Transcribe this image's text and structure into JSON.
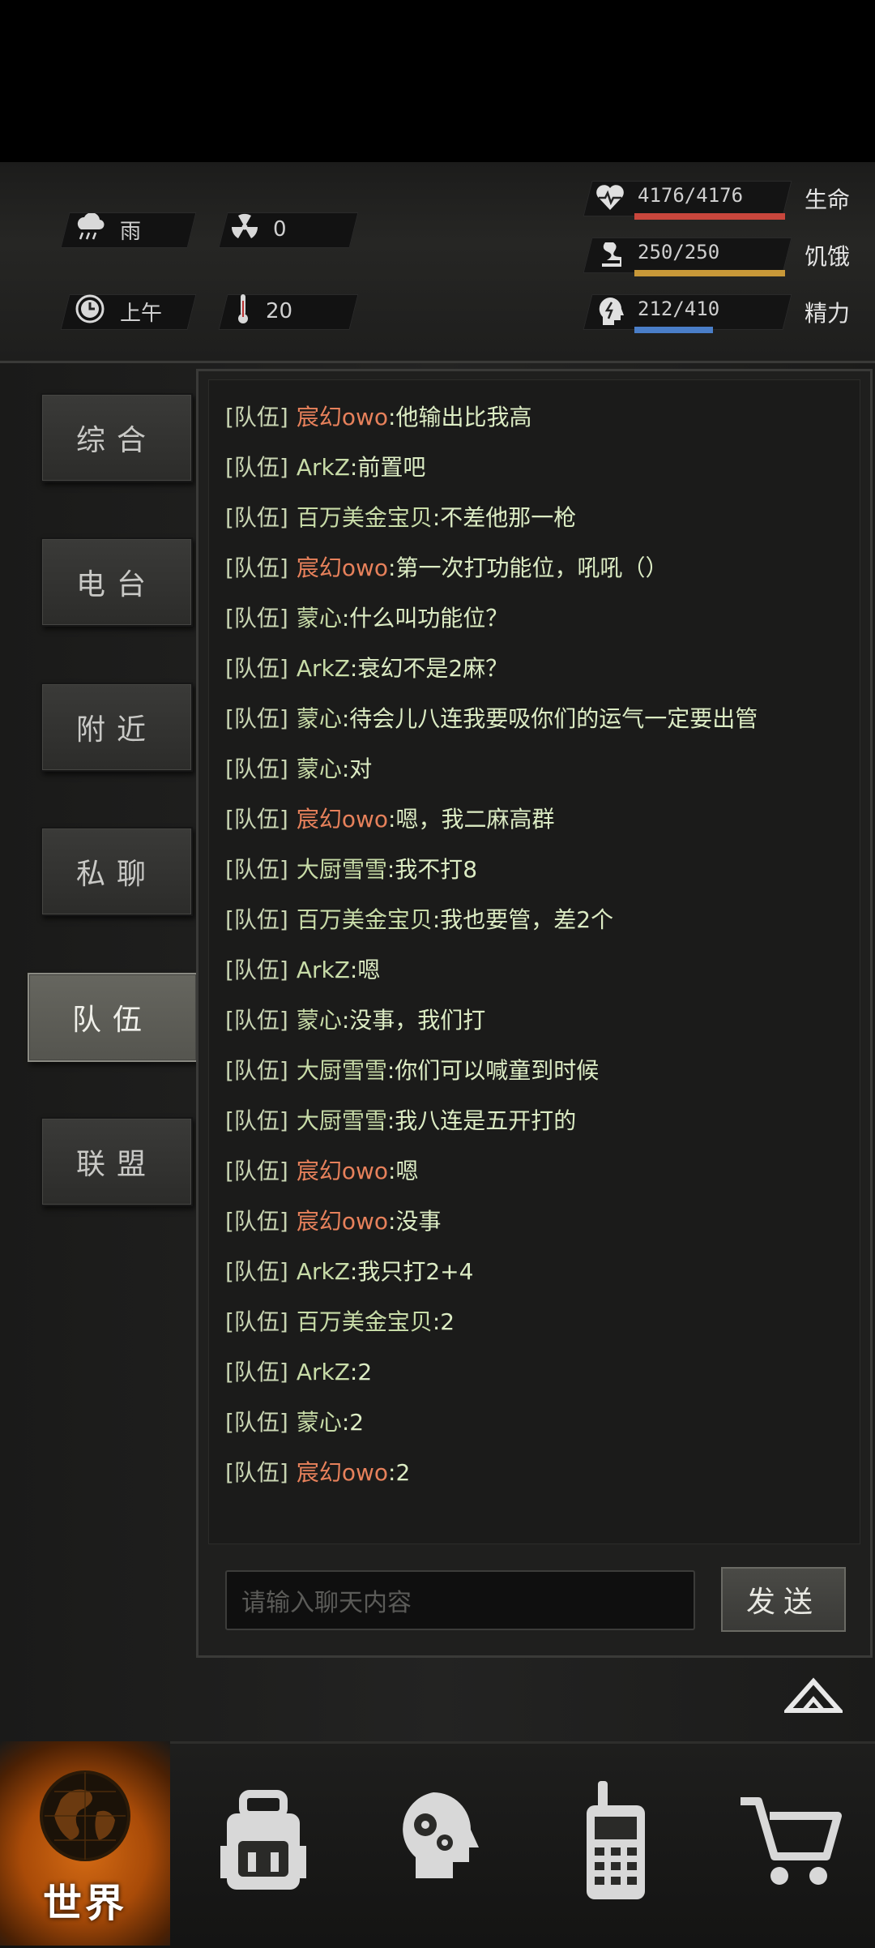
{
  "status": {
    "weather": {
      "icon": "rain-cloud-icon",
      "label": "雨"
    },
    "radiation": {
      "icon": "radiation-icon",
      "value": "0"
    },
    "time": {
      "icon": "clock-icon",
      "label": "上午"
    },
    "temperature": {
      "icon": "thermometer-icon",
      "value": "20"
    },
    "stats": [
      {
        "icon": "heart-pulse-icon",
        "value": "4176/4176",
        "label": "生命",
        "fill": 1.0,
        "color": "#c8463c"
      },
      {
        "icon": "hunger-icon",
        "value": "250/250",
        "label": "饥饿",
        "fill": 1.0,
        "color": "#c89838"
      },
      {
        "icon": "energy-head-icon",
        "value": "212/410",
        "label": "精力",
        "fill": 0.52,
        "color": "#4a7ec8"
      }
    ]
  },
  "tabs": [
    {
      "label": "综合",
      "active": false
    },
    {
      "label": "电台",
      "active": false
    },
    {
      "label": "附近",
      "active": false
    },
    {
      "label": "私聊",
      "active": false
    },
    {
      "label": "队伍",
      "active": true
    },
    {
      "label": "联盟",
      "active": false
    }
  ],
  "chat": {
    "messages": [
      {
        "channel": "[队伍]",
        "name": "宸幻owo",
        "orange": true,
        "text": ":他输出比我高"
      },
      {
        "channel": "[队伍]",
        "name": "ArkZ",
        "orange": false,
        "text": ":前置吧"
      },
      {
        "channel": "[队伍]",
        "name": "百万美金宝贝",
        "orange": false,
        "text": ":不差他那一枪"
      },
      {
        "channel": "[队伍]",
        "name": "宸幻owo",
        "orange": true,
        "text": ":第一次打功能位，吼吼（）"
      },
      {
        "channel": "[队伍]",
        "name": "蒙心",
        "orange": false,
        "text": ":什么叫功能位？"
      },
      {
        "channel": "[队伍]",
        "name": "ArkZ",
        "orange": false,
        "text": ":衰幻不是2麻？"
      },
      {
        "channel": "[队伍]",
        "name": "蒙心",
        "orange": false,
        "text": ":待会儿八连我要吸你们的运气一定要出管"
      },
      {
        "channel": "[队伍]",
        "name": "蒙心",
        "orange": false,
        "text": ":对"
      },
      {
        "channel": "[队伍]",
        "name": "宸幻owo",
        "orange": true,
        "text": ":嗯，我二麻高群"
      },
      {
        "channel": "[队伍]",
        "name": "大厨雪雪",
        "orange": false,
        "text": ":我不打8"
      },
      {
        "channel": "[队伍]",
        "name": "百万美金宝贝",
        "orange": false,
        "text": ":我也要管，差2个"
      },
      {
        "channel": "[队伍]",
        "name": "ArkZ",
        "orange": false,
        "text": ":嗯"
      },
      {
        "channel": "[队伍]",
        "name": "蒙心",
        "orange": false,
        "text": ":没事，我们打"
      },
      {
        "channel": "[队伍]",
        "name": "大厨雪雪",
        "orange": false,
        "text": ":你们可以喊童到时候"
      },
      {
        "channel": "[队伍]",
        "name": "大厨雪雪",
        "orange": false,
        "text": ":我八连是五开打的"
      },
      {
        "channel": "[队伍]",
        "name": "宸幻owo",
        "orange": true,
        "text": ":嗯"
      },
      {
        "channel": "[队伍]",
        "name": "宸幻owo",
        "orange": true,
        "text": ":没事"
      },
      {
        "channel": "[队伍]",
        "name": "ArkZ",
        "orange": false,
        "text": ":我只打2+4"
      },
      {
        "channel": "[队伍]",
        "name": "百万美金宝贝",
        "orange": false,
        "text": ":2"
      },
      {
        "channel": "[队伍]",
        "name": "ArkZ",
        "orange": false,
        "text": ":2"
      },
      {
        "channel": "[队伍]",
        "name": "蒙心",
        "orange": false,
        "text": ":2"
      },
      {
        "channel": "[队伍]",
        "name": "宸幻owo",
        "orange": true,
        "text": ":2"
      }
    ],
    "input_placeholder": "请输入聊天内容",
    "send_label": "发送"
  },
  "bottom_nav": [
    {
      "icon": "globe-icon",
      "label": "世界",
      "active": true
    },
    {
      "icon": "backpack-icon",
      "label": "",
      "active": false
    },
    {
      "icon": "head-gears-icon",
      "label": "",
      "active": false
    },
    {
      "icon": "walkie-talkie-icon",
      "label": "",
      "active": false
    },
    {
      "icon": "shopping-cart-icon",
      "label": "",
      "active": false
    }
  ]
}
